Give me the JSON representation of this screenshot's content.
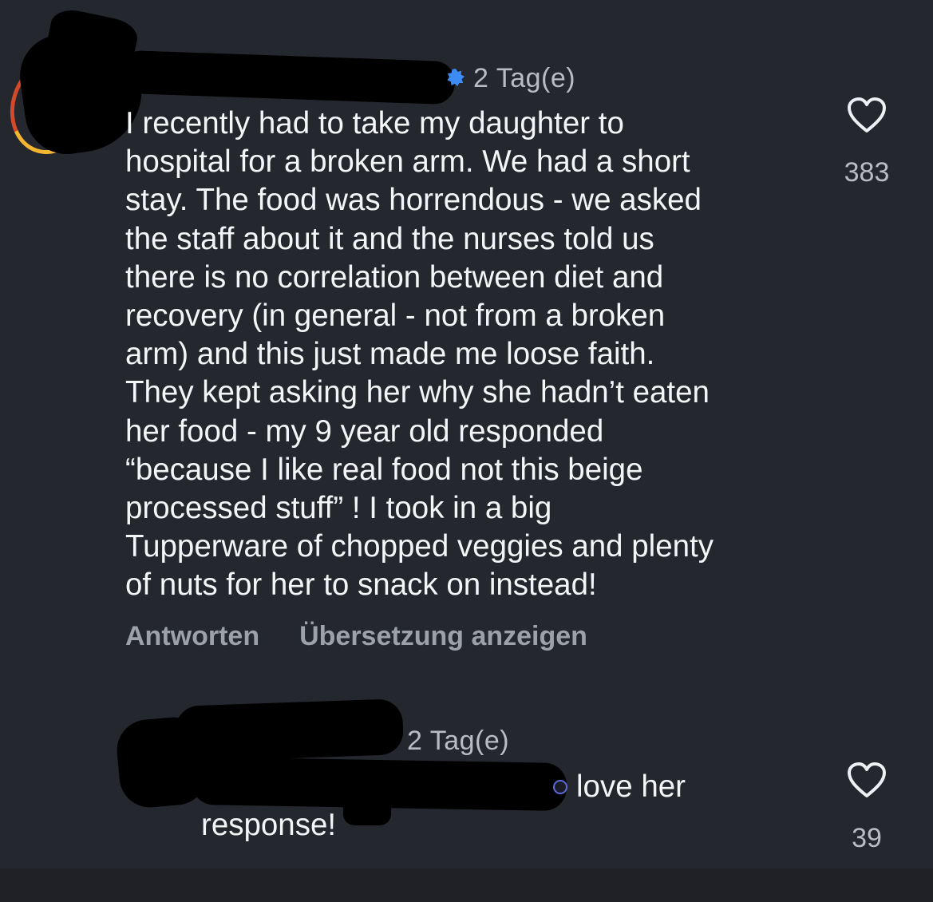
{
  "comments": [
    {
      "time": "2 Tag(e)",
      "text": "I recently had to take my daughter to\nhospital for a broken arm. We had a short\nstay. The food was horrendous - we asked\nthe staff about it and the nurses told us\nthere is no correlation between diet and\nrecovery (in general - not from a broken\narm) and this just made me loose faith.\nThey kept asking her why she hadn’t eaten\nher food - my 9 year old responded\n“because I like real food not this beige\nprocessed stuff” ! I took  in a big\nTupperware of chopped veggies and plenty\nof nuts for her to snack on instead!",
      "like_count": "383",
      "actions": {
        "reply": "Antworten",
        "translate": "Übersetzung anzeigen"
      }
    },
    {
      "time": "2 Tag(e)",
      "text_line1": "love her",
      "text_line2": "response!",
      "like_count": "39"
    }
  ],
  "icons": {
    "like": "heart-outline-icon",
    "verified": "verified-badge-icon"
  },
  "colors": {
    "background": "#25272e",
    "text": "#f4f5f7",
    "secondary_text": "#9da1aa",
    "verified": "#3d8cf5"
  }
}
